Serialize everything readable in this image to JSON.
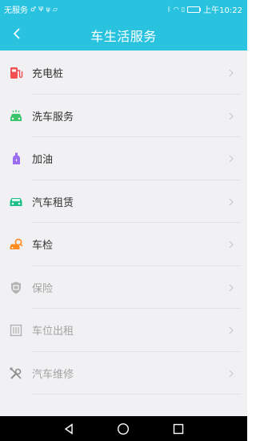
{
  "status_bar": {
    "carrier": "无服务",
    "time": "上午10:22",
    "battery_fill_fraction": 0.9
  },
  "header": {
    "title": "车生活服务",
    "back_icon": "chevron-left-icon"
  },
  "menu": {
    "items": [
      {
        "label": "充电桩",
        "icon": "charging-pile-icon",
        "color": "#f25050",
        "enabled": true
      },
      {
        "label": "洗车服务",
        "icon": "car-wash-icon",
        "color": "#3cc46a",
        "enabled": true
      },
      {
        "label": "加油",
        "icon": "fuel-bottle-icon",
        "color": "#9a6df0",
        "enabled": true
      },
      {
        "label": "汽车租赁",
        "icon": "car-rental-icon",
        "color": "#1fbf8a",
        "enabled": true
      },
      {
        "label": "车检",
        "icon": "car-inspection-icon",
        "color": "#ff8a1f",
        "enabled": true
      },
      {
        "label": "保险",
        "icon": "insurance-shield-icon",
        "color": "#b3b3b3",
        "enabled": false
      },
      {
        "label": "车位出租",
        "icon": "parking-space-icon",
        "color": "#b3b3b3",
        "enabled": false
      },
      {
        "label": "汽车维修",
        "icon": "repair-tools-icon",
        "color": "#9a9a9a",
        "enabled": false
      }
    ]
  },
  "colors": {
    "header_bg": "#29c3e0",
    "list_bg": "#f1f1f3",
    "text_enabled": "#333333",
    "text_disabled": "#a3a3a3"
  },
  "nav_bar": {
    "buttons": [
      "back-triangle-icon",
      "home-circle-icon",
      "recents-square-icon"
    ]
  }
}
